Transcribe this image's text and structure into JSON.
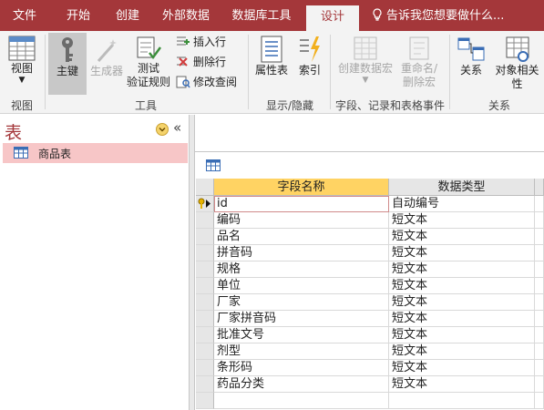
{
  "tabs": [
    {
      "label": "文件"
    },
    {
      "label": "开始"
    },
    {
      "label": "创建"
    },
    {
      "label": "外部数据"
    },
    {
      "label": "数据库工具"
    },
    {
      "label": "设计"
    }
  ],
  "tell_me": "告诉我您想要做什么...",
  "ribbon": {
    "view": "视图",
    "view_group": "视图",
    "primary_key": "主键",
    "builder": "生成器",
    "test_rules_1": "测试",
    "test_rules_2": "验证规则",
    "insert_rows": "插入行",
    "delete_rows": "删除行",
    "modify_lookups": "修改查阅",
    "tools_group": "工具",
    "property_sheet": "属性表",
    "indexes": "索引",
    "show_hide_group": "显示/隐藏",
    "create_macros": "创建数据宏",
    "rename_macro_1": "重命名/",
    "rename_macro_2": "删除宏",
    "field_events_group": "字段、记录和表格事件",
    "relationships": "关系",
    "object_dependencies": "对象相关性",
    "relationships_group": "关系"
  },
  "nav": {
    "title": "表",
    "collapse_glyph": "«",
    "items": [
      {
        "label": "商品表"
      }
    ]
  },
  "grid": {
    "headers": {
      "field_name": "字段名称",
      "data_type": "数据类型"
    },
    "rows": [
      {
        "name": "id",
        "type": "自动编号",
        "primary_key": true
      },
      {
        "name": "编码",
        "type": "短文本"
      },
      {
        "name": "品名",
        "type": "短文本"
      },
      {
        "name": "拼音码",
        "type": "短文本"
      },
      {
        "name": "规格",
        "type": "短文本"
      },
      {
        "name": "单位",
        "type": "短文本"
      },
      {
        "name": "厂家",
        "type": "短文本"
      },
      {
        "name": "厂家拼音码",
        "type": "短文本"
      },
      {
        "name": "批准文号",
        "type": "短文本"
      },
      {
        "name": "剂型",
        "type": "短文本"
      },
      {
        "name": "条形码",
        "type": "短文本"
      },
      {
        "name": "药品分类",
        "type": "短文本"
      },
      {
        "name": "",
        "type": ""
      }
    ]
  },
  "colors": {
    "accent": "#a4373a",
    "header_selected": "#ffd363",
    "nav_selected": "#f7c6c7"
  }
}
